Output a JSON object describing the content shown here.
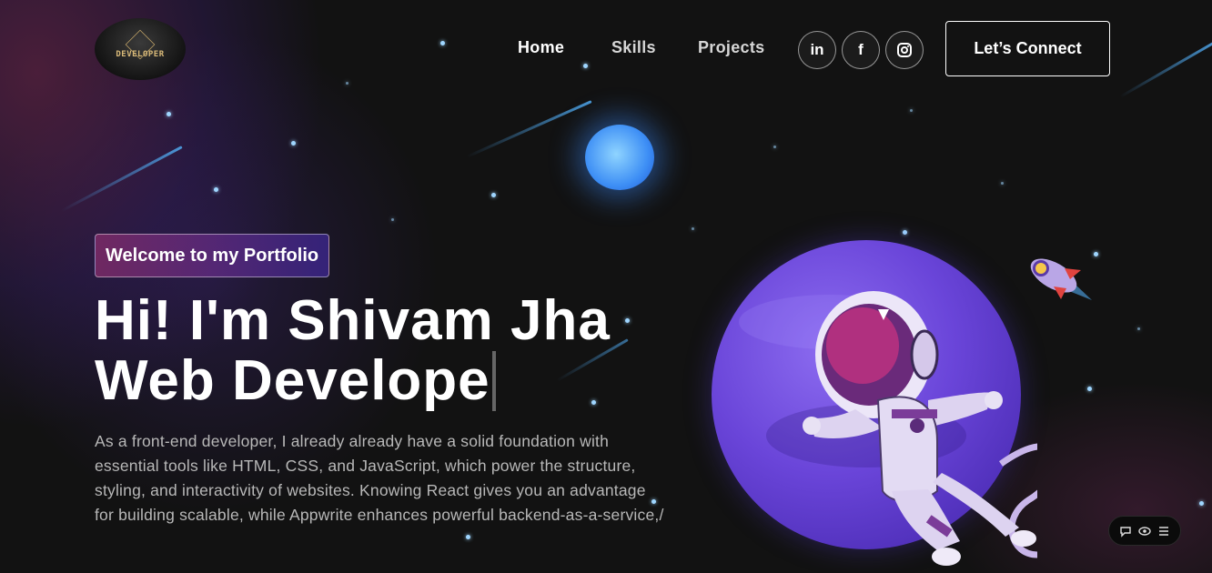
{
  "logo": {
    "text": "DEVELOPER"
  },
  "nav": {
    "links": [
      {
        "label": "Home",
        "active": true
      },
      {
        "label": "Skills"
      },
      {
        "label": "Projects"
      }
    ],
    "social": [
      {
        "label": "in",
        "icon": "linkedin-icon"
      },
      {
        "label": "f",
        "icon": "facebook-icon"
      },
      {
        "label": "",
        "icon": "instagram-icon"
      }
    ],
    "connect_label": "Let’s Connect"
  },
  "hero": {
    "tagline": "Welcome to my Portfolio",
    "headline_line1": "Hi! I'm Shivam Jha",
    "headline_line2": "Web Develope",
    "description": "As a front-end developer, I already already have a solid foundation with essential tools like HTML, CSS, and JavaScript, which power the structure, styling, and interactivity of websites. Knowing React gives you an advantage for building scalable, while Appwrite enhances powerful backend-as-a-service,/"
  },
  "floating_toolbar": {
    "icons": [
      "chat-icon",
      "eye-icon",
      "menu-icon"
    ]
  },
  "colors": {
    "background": "#121212",
    "tagline_gradient_start": "#aa367c",
    "tagline_gradient_end": "#4a2fbd",
    "planet": "#6a45d9",
    "moon": "#3e8ff5",
    "star": "#9fd6ff"
  }
}
